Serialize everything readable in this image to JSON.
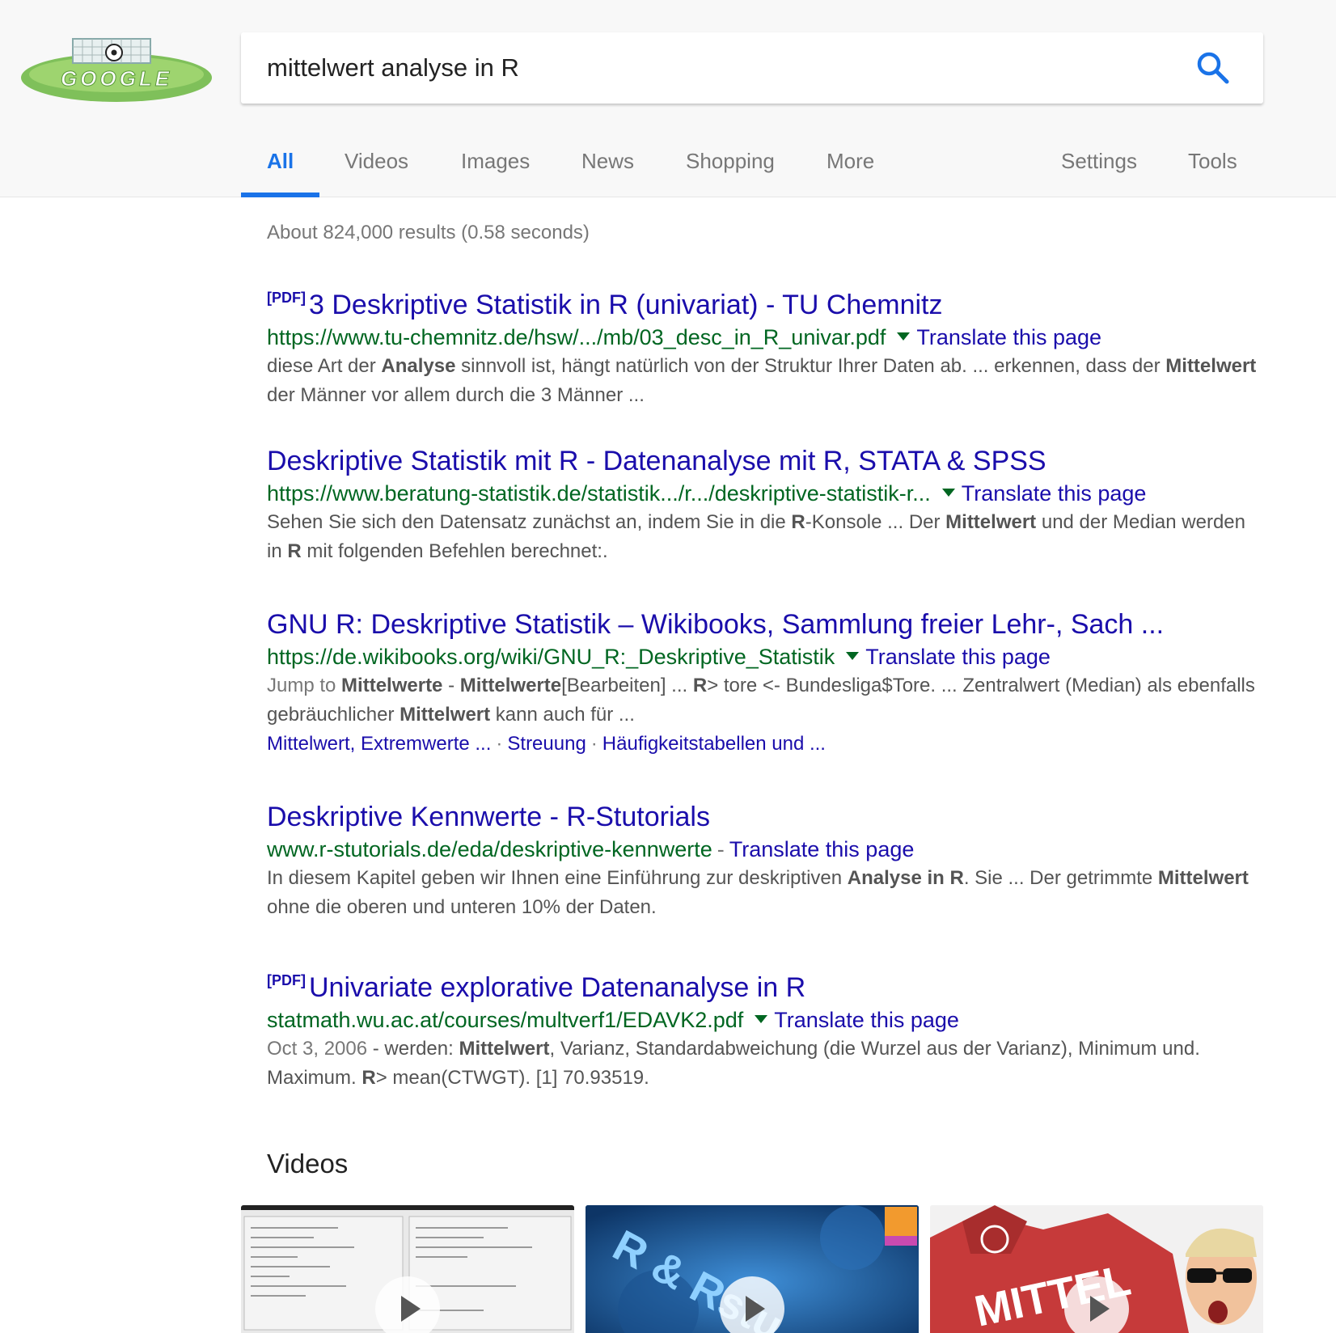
{
  "search": {
    "query": "mittelwert analyse in R"
  },
  "logo": {
    "text": "GOOGLE"
  },
  "tabs": [
    "All",
    "Videos",
    "Images",
    "News",
    "Shopping",
    "More"
  ],
  "tools_tabs": [
    "Settings",
    "Tools"
  ],
  "stats": "About 824,000 results (0.58 seconds)",
  "pdf_tag": "[PDF]",
  "translate_label": "Translate this page",
  "results": [
    {
      "title": "3 Deskriptive Statistik in R (univariat) - TU Chemnitz",
      "url": "https://www.tu-chemnitz.de/hsw/.../mb/03_desc_in_R_univar.pdf",
      "snippet": [
        {
          "t": "diese Art der "
        },
        {
          "t": "Analyse",
          "b": true
        },
        {
          "t": " sinnvoll ist, hängt natürlich von der Struktur Ihrer Daten ab. ... erkennen, dass der "
        },
        {
          "t": "Mittelwert",
          "b": true
        },
        {
          "t": " der Männer vor allem durch die 3 Männer ..."
        }
      ]
    },
    {
      "title": "Deskriptive Statistik mit R - Datenanalyse mit R, STATA & SPSS",
      "url": "https://www.beratung-statistik.de/statistik.../r.../deskriptive-statistik-r...",
      "snippet": [
        {
          "t": "Sehen Sie sich den Datensatz zunächst an, indem Sie in die "
        },
        {
          "t": "R",
          "b": true
        },
        {
          "t": "-Konsole ... Der "
        },
        {
          "t": "Mittelwert",
          "b": true
        },
        {
          "t": " und der Median werden in "
        },
        {
          "t": "R",
          "b": true
        },
        {
          "t": " mit folgenden Befehlen berechnet:."
        }
      ]
    },
    {
      "title": "GNU R: Deskriptive Statistik – Wikibooks, Sammlung freier Lehr-, Sach ...",
      "url": "https://de.wikibooks.org/wiki/GNU_R:_Deskriptive_Statistik",
      "jump_label": "Jump to",
      "jump_target": "Mittelwerte",
      "snippet": [
        {
          "t": " - "
        },
        {
          "t": "Mittelwerte",
          "b": true
        },
        {
          "t": "[Bearbeiten] ... "
        },
        {
          "t": "R",
          "b": true
        },
        {
          "t": "> tore <- Bundesliga$Tore. ... Zentralwert (Median) als ebenfalls gebräuchlicher "
        },
        {
          "t": "Mittelwert",
          "b": true
        },
        {
          "t": " kann auch für ..."
        }
      ],
      "sitelinks": [
        "Mittelwert, Extremwerte ...",
        "Streuung",
        "Häufigkeitstabellen und ..."
      ]
    },
    {
      "title": "Deskriptive Kennwerte - R-Stutorials",
      "url": "www.r-stutorials.de/eda/deskriptive-kennwerte",
      "snippet": [
        {
          "t": "In diesem Kapitel geben wir Ihnen eine Einführung zur deskriptiven "
        },
        {
          "t": "Analyse in R",
          "b": true
        },
        {
          "t": ". Sie ... Der getrimmte "
        },
        {
          "t": "Mittelwert",
          "b": true
        },
        {
          "t": " ohne die oberen und unteren 10% der Daten."
        }
      ]
    },
    {
      "title": "Univariate explorative Datenanalyse in R",
      "url": "statmath.wu.ac.at/courses/multverf1/EDAVK2.pdf",
      "date": "Oct 3, 2006",
      "snippet": [
        {
          "t": " - werden: "
        },
        {
          "t": "Mittelwert",
          "b": true
        },
        {
          "t": ", Varianz, Standardabweichung (die Wurzel aus der Varianz), Minimum und. Maximum. "
        },
        {
          "t": "R",
          "b": true
        },
        {
          "t": "> mean(CTWGT). [1] 70.93519."
        }
      ]
    }
  ],
  "videos": {
    "heading": "Videos",
    "thumb2_text": "R & Rstu",
    "thumb3_text": "MITTEL"
  },
  "colors": {
    "link": "#1a0dab",
    "url": "#006621",
    "accent": "#1a73e8",
    "snippet": "#545454",
    "muted": "#777777"
  }
}
